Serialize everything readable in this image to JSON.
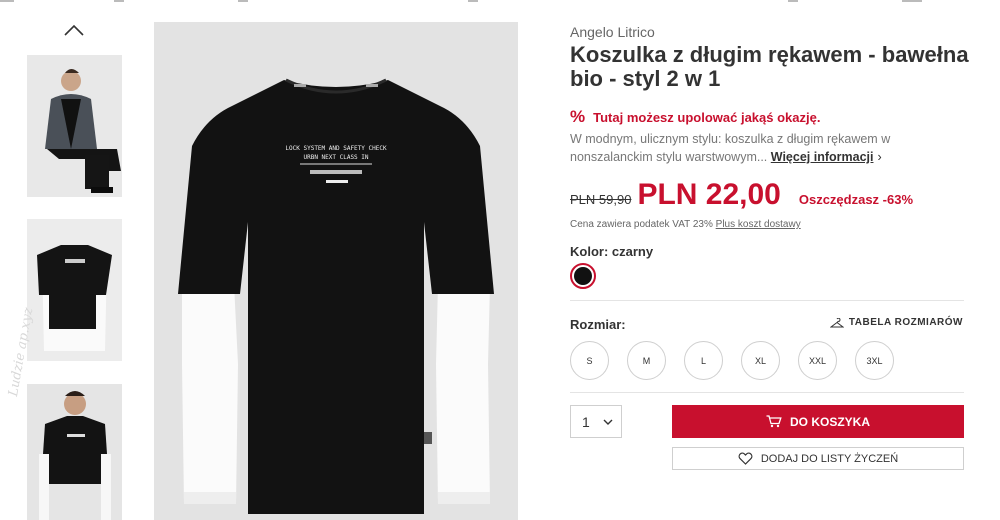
{
  "product": {
    "brand": "Angelo Litrico",
    "title": "Koszulka z długim rękawem - bawełna bio - styl 2 w 1",
    "promo_icon": "%",
    "promo_text": "Tutaj możesz upolować jakąś okazję.",
    "description": "W modnym, ulicznym stylu: koszulka z długim rękawem w nonszalanckim stylu warstwowym...",
    "more_info": "Więcej informacji",
    "old_price": "PLN 59,90",
    "new_price": "PLN 22,00",
    "saving": "Oszczędzasz -63%",
    "vat_text": "Cena zawiera podatek VAT 23%",
    "shipping_link": "Plus koszt dostawy",
    "color_label": "Kolor: czarny",
    "size_label": "Rozmiar:",
    "size_table": "TABELA ROZMIARÓW",
    "sizes": [
      "S",
      "M",
      "L",
      "XL",
      "XXL",
      "3XL"
    ],
    "quantity": "1",
    "add_to_cart": "DO KOSZYKA",
    "add_to_wishlist": "DODAJ DO LISTY ŻYCZEŃ"
  },
  "gallery": {
    "shirt_print": [
      "LOCK SYSTEM AND SAFETY CHECK",
      "URBN NEXT CLASS IN"
    ]
  },
  "watermark": "Ludzie ap.xyz",
  "colors": {
    "accent": "#c8102e",
    "swatch": "#111111"
  },
  "icons": [
    "chevron-up-icon",
    "percent-icon",
    "chevron-right-icon",
    "hanger-icon",
    "chevron-down-icon",
    "cart-icon",
    "heart-icon"
  ]
}
